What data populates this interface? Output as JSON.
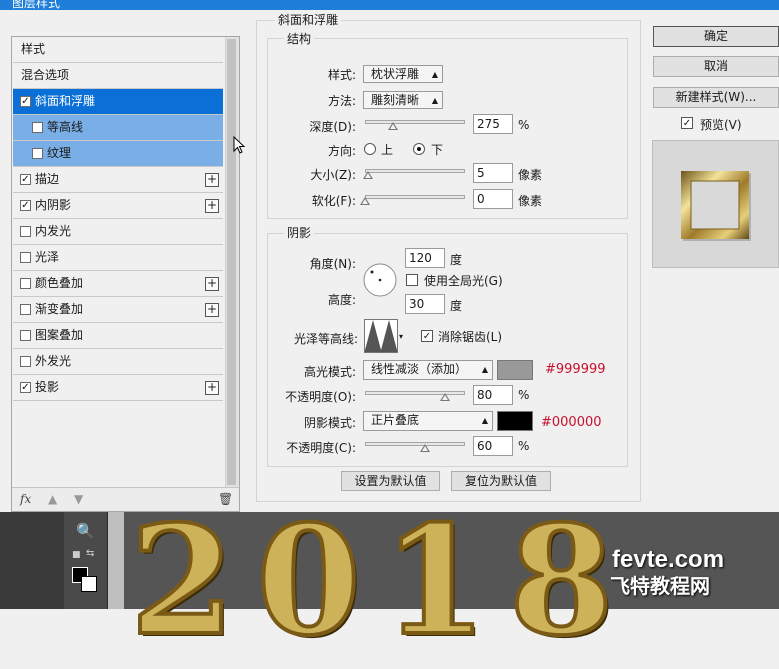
{
  "window_title": "图层样式",
  "style_list": {
    "items": [
      {
        "label": "样式",
        "checkbox": false,
        "checked": false,
        "plus": false,
        "state": "normal"
      },
      {
        "label": "混合选项",
        "checkbox": false,
        "checked": false,
        "plus": false,
        "state": "normal"
      },
      {
        "label": "斜面和浮雕",
        "checkbox": true,
        "checked": true,
        "plus": false,
        "state": "selected"
      },
      {
        "label": "等高线",
        "checkbox": true,
        "checked": false,
        "plus": false,
        "state": "sub"
      },
      {
        "label": "纹理",
        "checkbox": true,
        "checked": false,
        "plus": false,
        "state": "sub"
      },
      {
        "label": "描边",
        "checkbox": true,
        "checked": true,
        "plus": true,
        "state": "normal"
      },
      {
        "label": "内阴影",
        "checkbox": true,
        "checked": true,
        "plus": true,
        "state": "normal"
      },
      {
        "label": "内发光",
        "checkbox": true,
        "checked": false,
        "plus": false,
        "state": "normal"
      },
      {
        "label": "光泽",
        "checkbox": true,
        "checked": false,
        "plus": false,
        "state": "normal"
      },
      {
        "label": "颜色叠加",
        "checkbox": true,
        "checked": false,
        "plus": true,
        "state": "normal"
      },
      {
        "label": "渐变叠加",
        "checkbox": true,
        "checked": false,
        "plus": true,
        "state": "normal"
      },
      {
        "label": "图案叠加",
        "checkbox": true,
        "checked": false,
        "plus": false,
        "state": "normal"
      },
      {
        "label": "外发光",
        "checkbox": true,
        "checked": false,
        "plus": false,
        "state": "normal"
      },
      {
        "label": "投影",
        "checkbox": true,
        "checked": true,
        "plus": true,
        "state": "normal"
      }
    ],
    "fx_label": "fx"
  },
  "bevel": {
    "section_title": "斜面和浮雕",
    "structure": {
      "title": "结构",
      "style_label": "样式:",
      "style_value": "枕状浮雕",
      "technique_label": "方法:",
      "technique_value": "雕刻清晰",
      "depth_label": "深度(D):",
      "depth_value": "275",
      "depth_unit": "%",
      "depth_level": 0.28,
      "direction_label": "方向:",
      "dir_up": "上",
      "dir_down": "下",
      "direction_selected": "下",
      "size_label": "大小(Z):",
      "size_value": "5",
      "size_unit": "像素",
      "size_level": 0.03,
      "soften_label": "软化(F):",
      "soften_value": "0",
      "soften_unit": "像素",
      "soften_level": 0.0
    },
    "shading": {
      "title": "阴影",
      "angle_label": "角度(N):",
      "angle_value": "120",
      "angle_unit": "度",
      "global_light_label": "使用全局光(G)",
      "global_light_checked": false,
      "altitude_label": "高度:",
      "altitude_value": "30",
      "altitude_unit": "度",
      "gloss_label": "光泽等高线:",
      "antialias_label": "消除锯齿(L)",
      "antialias_checked": true,
      "highlight_mode_label": "高光模式:",
      "highlight_mode_value": "线性减淡（添加）",
      "highlight_color": "#999999",
      "highlight_hex_text": "#999999",
      "highlight_opacity_label": "不透明度(O):",
      "highlight_opacity_value": "80",
      "highlight_opacity_unit": "%",
      "highlight_opacity_level": 0.8,
      "shadow_mode_label": "阴影模式:",
      "shadow_mode_value": "正片叠底",
      "shadow_color": "#000000",
      "shadow_hex_text": "#000000",
      "shadow_opacity_label": "不透明度(C):",
      "shadow_opacity_value": "60",
      "shadow_opacity_unit": "%",
      "shadow_opacity_level": 0.6
    },
    "set_default": "设置为默认值",
    "reset_default": "复位为默认值"
  },
  "actions": {
    "ok": "确定",
    "cancel": "取消",
    "new_style": "新建样式(W)...",
    "preview_label": "预览(V)",
    "preview_checked": true
  },
  "canvas": {
    "headline": "2018",
    "watermark_line1": "fevte.com",
    "watermark_line2": "飞特教程网"
  },
  "colors": {
    "selection": "#0a6fd6",
    "sub_selection": "#79aee6",
    "hex_text": "#c8102e"
  }
}
